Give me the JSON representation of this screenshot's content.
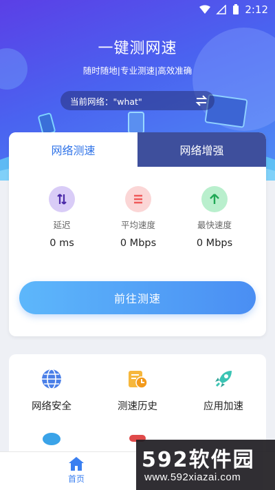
{
  "status_bar": {
    "time": "2:12"
  },
  "hero": {
    "title": "一键测网速",
    "subtitle": "随时随地|专业测速|高效准确",
    "network_label": "当前网络：\"what\""
  },
  "tabs": [
    {
      "label": "网络测速",
      "active": true
    },
    {
      "label": "网络增强",
      "active": false
    }
  ],
  "metrics": [
    {
      "label": "延迟",
      "value": "0 ms",
      "icon": "updown-arrows-icon",
      "color": "#7b55d9"
    },
    {
      "label": "平均速度",
      "value": "0 Mbps",
      "icon": "menu-lines-icon",
      "color": "#ef5a5a"
    },
    {
      "label": "最快速度",
      "value": "0 Mbps",
      "icon": "up-arrow-icon",
      "color": "#34c26c"
    }
  ],
  "start_button": {
    "label": "前往测速"
  },
  "tools_row1": [
    {
      "label": "网络安全",
      "icon": "globe-icon"
    },
    {
      "label": "测速历史",
      "icon": "history-icon"
    },
    {
      "label": "应用加速",
      "icon": "rocket-icon"
    }
  ],
  "bottom_nav": {
    "home_label": "首页"
  },
  "watermark": {
    "brand": "592软件园",
    "url": "www.592xiazai.com"
  },
  "colors": {
    "accent": "#2f73e8",
    "hero_start": "#5b3fe6",
    "hero_end": "#4f8ff5",
    "tab_inactive": "#3e4f9c"
  }
}
